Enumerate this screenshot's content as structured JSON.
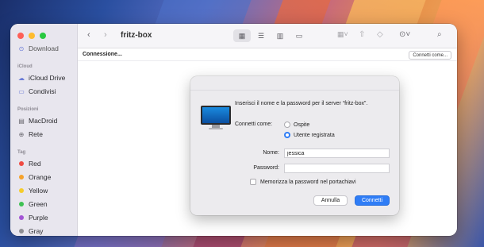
{
  "window": {
    "title": "fritz-box"
  },
  "sidebar": {
    "partial_item": "Download",
    "sections": {
      "icloud": "iCloud",
      "locations": "Posizioni",
      "tags": "Tag"
    },
    "icloud_items": [
      {
        "label": "iCloud Drive",
        "icon": "cloud-icon"
      },
      {
        "label": "Condivisi",
        "icon": "shared-folder-icon"
      }
    ],
    "location_items": [
      {
        "label": "MacDroid",
        "icon": "drive-icon"
      },
      {
        "label": "Rete",
        "icon": "network-icon"
      }
    ],
    "tag_items": [
      {
        "label": "Red",
        "color": "#f04b43"
      },
      {
        "label": "Orange",
        "color": "#f6a22b"
      },
      {
        "label": "Yellow",
        "color": "#f5cc2b"
      },
      {
        "label": "Green",
        "color": "#3ec153"
      },
      {
        "label": "Purple",
        "color": "#a355d5"
      },
      {
        "label": "Gray",
        "color": "#8e8e93"
      }
    ]
  },
  "pathbar": {
    "status": "Connessione...",
    "connect_as_button": "Connetti come..."
  },
  "dialog": {
    "prompt": "Inserisci il nome e la password per il server “fritz-box”.",
    "connect_as_label": "Connetti come:",
    "options": [
      {
        "label": "Ospite",
        "selected": false
      },
      {
        "label": "Utente registrata",
        "selected": true
      }
    ],
    "name_label": "Nome:",
    "name_value": "jessica",
    "password_label": "Password:",
    "password_value": "",
    "remember_label": "Memorizza la password nel portachiavi",
    "remember_checked": false,
    "cancel_button": "Annulla",
    "ok_button": "Connetti"
  },
  "colors": {
    "accent": "#2f7df6"
  }
}
